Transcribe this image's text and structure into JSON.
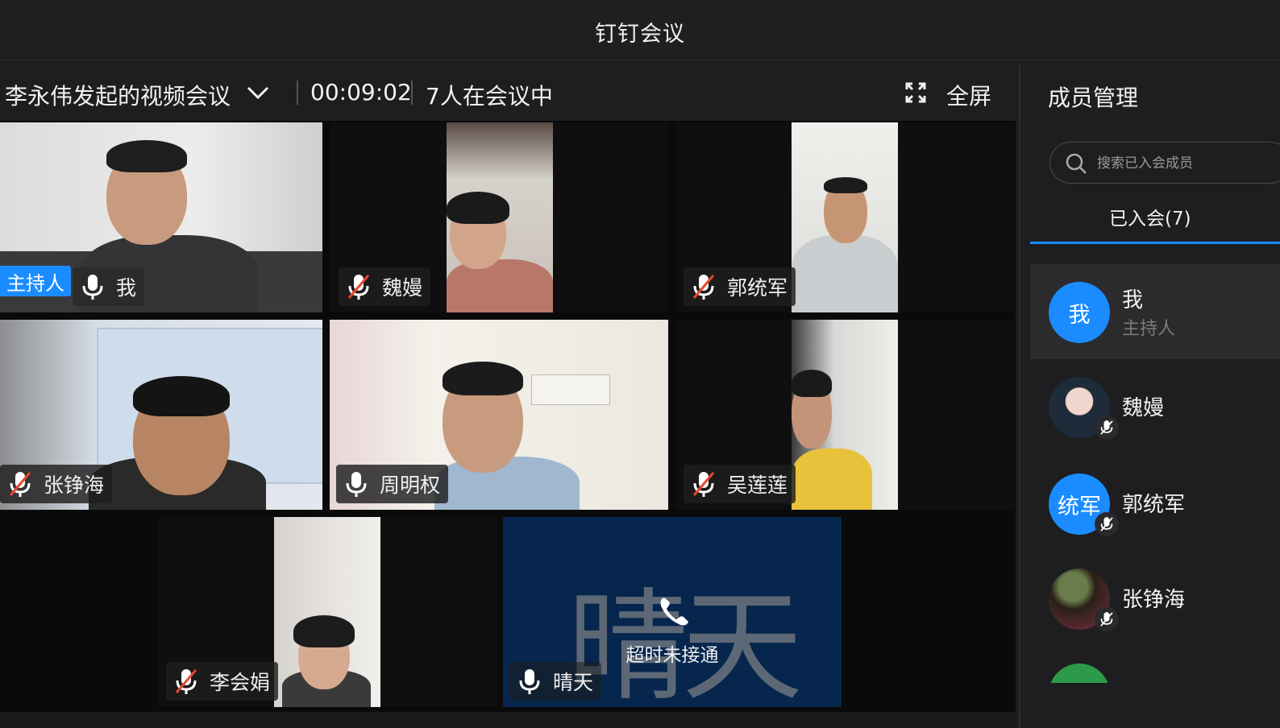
{
  "window": {
    "title": "钉钉会议"
  },
  "meeting": {
    "name": "李永伟发起的视频会议",
    "elapsed": "00:09:02",
    "participants_text": "7人在会议中",
    "fullscreen_label": "全屏"
  },
  "tiles": [
    {
      "name": "我",
      "muted": false,
      "host_badge": "主持人"
    },
    {
      "name": "魏嫚",
      "muted": true
    },
    {
      "name": "郭统军",
      "muted": true
    },
    {
      "name": "张铮海",
      "muted": true
    },
    {
      "name": "周明权",
      "muted": false,
      "active_speaker": true
    },
    {
      "name": "吴莲莲",
      "muted": true
    },
    {
      "name": "李会娟",
      "muted": true
    },
    {
      "name": "晴天",
      "muted": false,
      "placeholder_text": "晴天",
      "call_status": "超时未接通"
    }
  ],
  "panel": {
    "title": "成员管理",
    "search_placeholder": "搜索已入会成员",
    "tab_label": "已入会(7)",
    "members": [
      {
        "avatar_text": "我",
        "name": "我",
        "role": "主持人",
        "selected": true
      },
      {
        "avatar_text": "",
        "name": "魏嫚",
        "muted": true
      },
      {
        "avatar_text": "统军",
        "name": "郭统军",
        "muted": true
      },
      {
        "avatar_text": "",
        "name": "张铮海",
        "muted": true
      }
    ]
  },
  "colors": {
    "accent": "#1a8cff",
    "active_speaker": "#22b04d",
    "mute_red": "#e8462f",
    "placeholder_bg": "#06264d"
  }
}
